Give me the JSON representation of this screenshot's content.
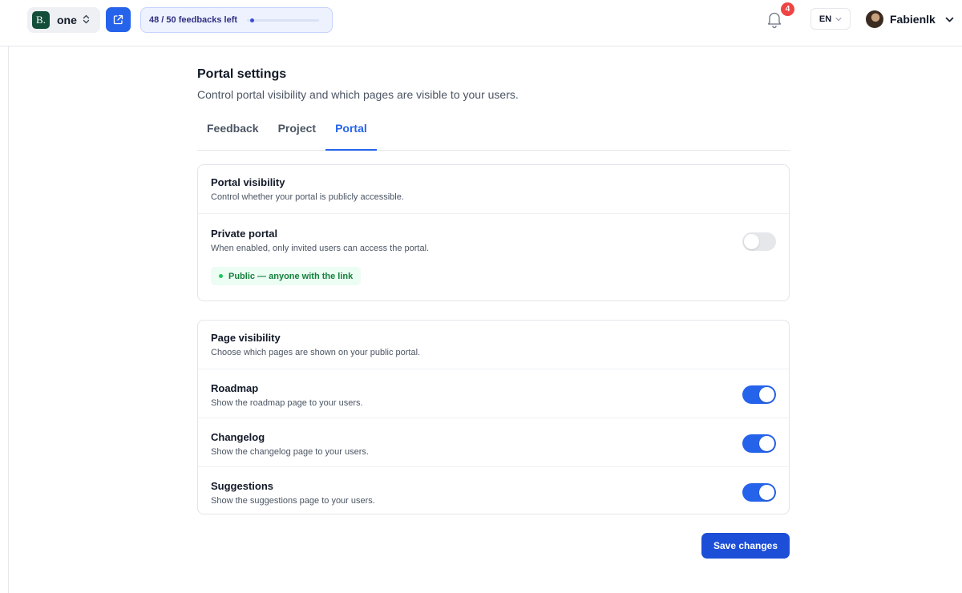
{
  "header": {
    "workspace": {
      "logo_letter": "B.",
      "name": "one",
      "chevron": "⌃⌄"
    },
    "quota": {
      "text": "48 / 50 feedbacks left",
      "used_fraction": 0.04
    },
    "notifications": {
      "count": "4"
    },
    "language": {
      "value": "EN"
    },
    "user": {
      "name": "Fabienlk"
    }
  },
  "page": {
    "title": "Portal settings",
    "subtitle": "Control portal visibility and which pages are visible to your users."
  },
  "tabs": [
    {
      "label": "Feedback",
      "active": false
    },
    {
      "label": "Project",
      "active": false
    },
    {
      "label": "Portal",
      "active": true
    }
  ],
  "portal_visibility": {
    "title": "Portal visibility",
    "subtitle": "Control whether your portal is publicly accessible.",
    "private": {
      "title": "Private portal",
      "subtitle": "When enabled, only invited users can access the portal.",
      "enabled": false
    },
    "status": "Public — anyone with the link"
  },
  "page_visibility": {
    "title": "Page visibility",
    "subtitle": "Choose which pages are shown on your public portal.",
    "items": [
      {
        "title": "Roadmap",
        "subtitle": "Show the roadmap page to your users.",
        "enabled": true
      },
      {
        "title": "Changelog",
        "subtitle": "Show the changelog page to your users.",
        "enabled": true
      },
      {
        "title": "Suggestions",
        "subtitle": "Show the suggestions page to your users.",
        "enabled": true
      }
    ]
  },
  "actions": {
    "save_label": "Save changes"
  },
  "colors": {
    "accent": "#2563eb",
    "success": "#15803d",
    "badge": "#ef4444"
  }
}
